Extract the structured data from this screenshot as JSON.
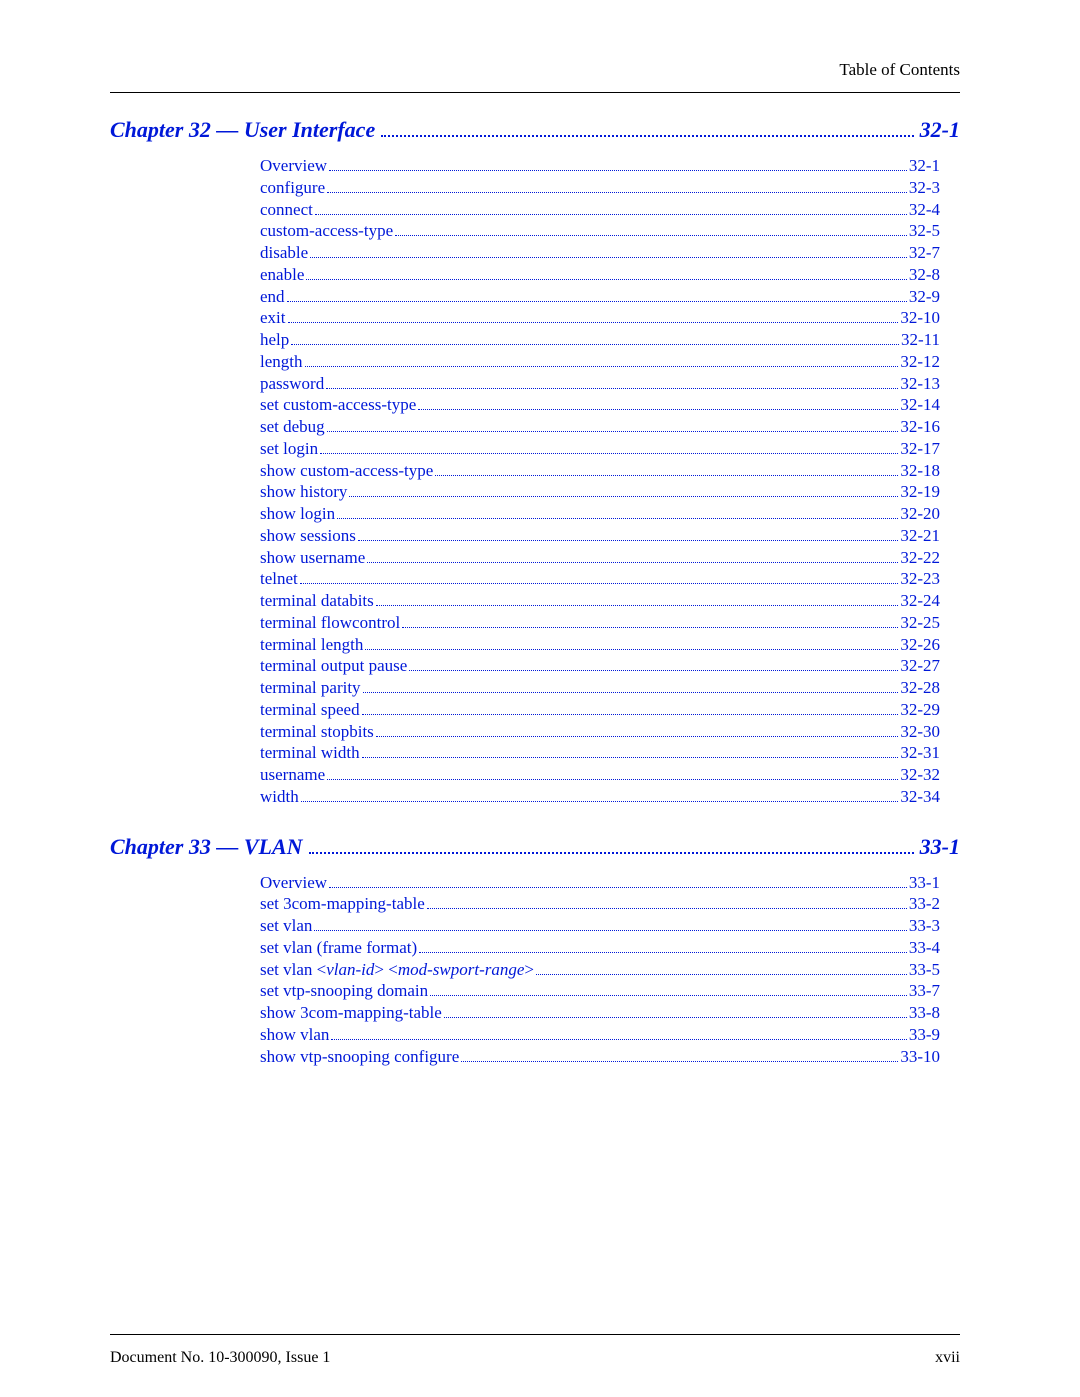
{
  "header": "Table of Contents",
  "footer_left": "Document No. 10-300090, Issue 1",
  "footer_right": "xvii",
  "chapters": [
    {
      "title": "Chapter 32 — User Interface",
      "page": "32-1",
      "entries": [
        {
          "title": "Overview",
          "page": "32-1"
        },
        {
          "title": "configure",
          "page": "32-3"
        },
        {
          "title": "connect",
          "page": "32-4"
        },
        {
          "title": "custom-access-type",
          "page": "32-5"
        },
        {
          "title": "disable",
          "page": "32-7"
        },
        {
          "title": "enable",
          "page": "32-8"
        },
        {
          "title": "end",
          "page": "32-9"
        },
        {
          "title": "exit",
          "page": "32-10"
        },
        {
          "title": "help",
          "page": "32-11"
        },
        {
          "title": "length",
          "page": "32-12"
        },
        {
          "title": "password",
          "page": "32-13"
        },
        {
          "title": "set custom-access-type",
          "page": "32-14"
        },
        {
          "title": "set debug",
          "page": "32-16"
        },
        {
          "title": "set login",
          "page": "32-17"
        },
        {
          "title": "show custom-access-type",
          "page": "32-18"
        },
        {
          "title": "show history",
          "page": "32-19"
        },
        {
          "title": "show login",
          "page": "32-20"
        },
        {
          "title": "show sessions",
          "page": "32-21"
        },
        {
          "title": "show username",
          "page": "32-22"
        },
        {
          "title": "telnet",
          "page": "32-23"
        },
        {
          "title": "terminal databits",
          "page": "32-24"
        },
        {
          "title": "terminal flowcontrol",
          "page": "32-25"
        },
        {
          "title": "terminal length",
          "page": "32-26"
        },
        {
          "title": "terminal output pause",
          "page": "32-27"
        },
        {
          "title": "terminal parity",
          "page": "32-28"
        },
        {
          "title": "terminal speed",
          "page": "32-29"
        },
        {
          "title": "terminal stopbits",
          "page": "32-30"
        },
        {
          "title": "terminal width",
          "page": "32-31"
        },
        {
          "title": "username",
          "page": "32-32"
        },
        {
          "title": "width",
          "page": "32-34"
        }
      ]
    },
    {
      "title": "Chapter 33 — VLAN",
      "page": "33-1",
      "entries": [
        {
          "title": "Overview",
          "page": "33-1"
        },
        {
          "title": "set 3com-mapping-table",
          "page": "33-2"
        },
        {
          "title": "set vlan",
          "page": "33-3"
        },
        {
          "title": "set vlan (frame format)",
          "page": "33-4"
        },
        {
          "title_html": "set vlan <span class='lt'>&lt;</span><span class='italic-arg'>vlan-id</span><span class='gt'>&gt;</span> <span class='lt'>&lt;</span><span class='italic-arg'>mod-swport-range</span><span class='gt'>&gt;</span>",
          "page": "33-5"
        },
        {
          "title": "set vtp-snooping domain",
          "page": "33-7"
        },
        {
          "title": "show 3com-mapping-table",
          "page": "33-8"
        },
        {
          "title": "show vlan",
          "page": "33-9"
        },
        {
          "title": "show vtp-snooping configure",
          "page": "33-10"
        }
      ]
    }
  ]
}
